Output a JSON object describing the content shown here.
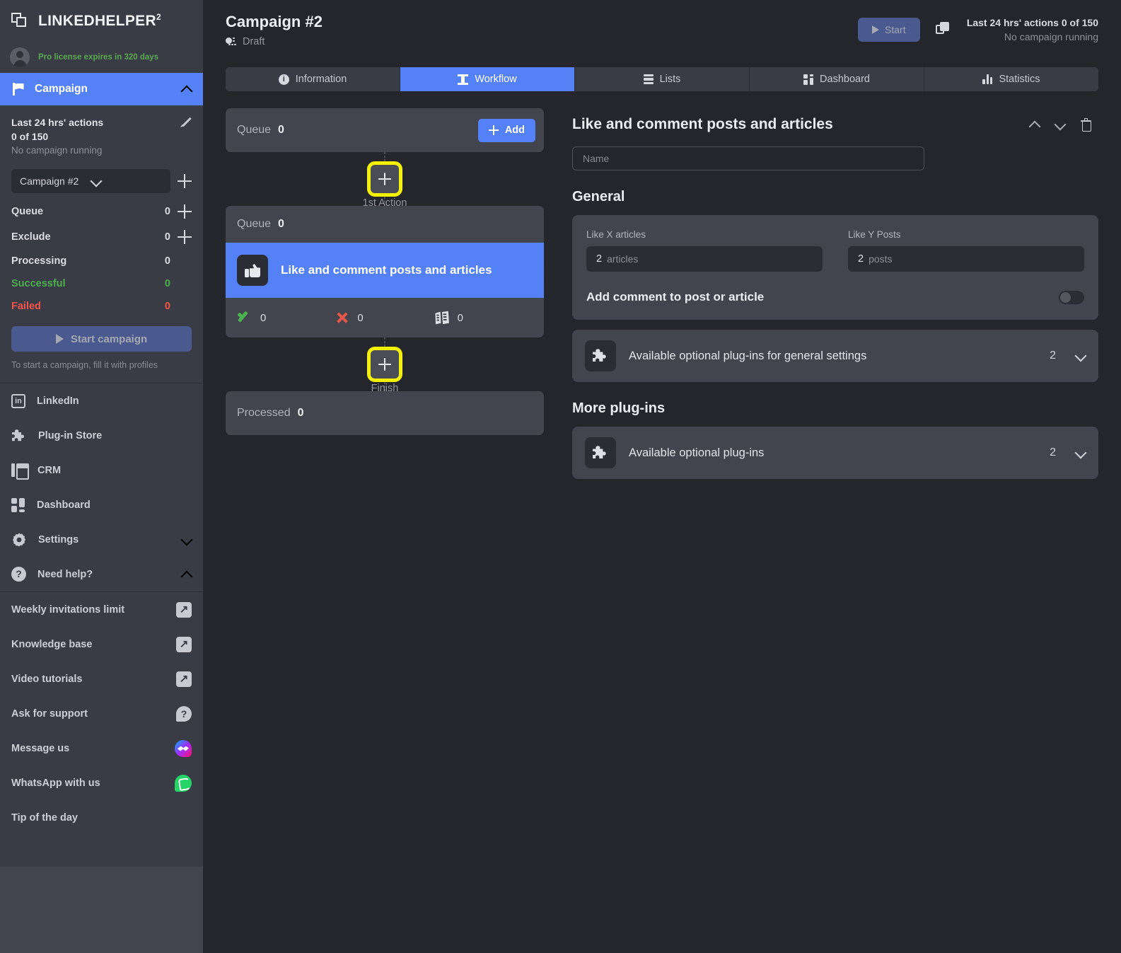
{
  "sidebar": {
    "logo": {
      "text": "LINKEDHELPER",
      "sup": "2"
    },
    "account": {
      "license": "Pro license expires in 320 days"
    },
    "campaign_header": {
      "label": "Campaign"
    },
    "stats": {
      "title": "Last 24 hrs' actions",
      "value": "0 of 150",
      "subtitle": "No campaign running"
    },
    "campaign_select": {
      "value": "Campaign #2"
    },
    "counters": [
      {
        "name": "Queue",
        "value": "0",
        "has_add": true,
        "tone": "normal"
      },
      {
        "name": "Exclude",
        "value": "0",
        "has_add": true,
        "tone": "normal"
      },
      {
        "name": "Processing",
        "value": "0",
        "has_add": false,
        "tone": "normal"
      },
      {
        "name": "Successful",
        "value": "0",
        "has_add": false,
        "tone": "green"
      },
      {
        "name": "Failed",
        "value": "0",
        "has_add": false,
        "tone": "red"
      }
    ],
    "start_campaign": {
      "label": "Start campaign"
    },
    "hint": "To start a campaign, fill it with profiles",
    "nav": [
      {
        "label": "LinkedIn",
        "icon": "linkedin-icon"
      },
      {
        "label": "Plug-in Store",
        "icon": "puzzle-icon"
      },
      {
        "label": "CRM",
        "icon": "crm-icon"
      },
      {
        "label": "Dashboard",
        "icon": "dashboard-icon"
      },
      {
        "label": "Settings",
        "icon": "gear-icon"
      },
      {
        "label": "Need help?",
        "icon": "help-icon"
      }
    ],
    "help_items": [
      {
        "label": "Weekly invitations limit",
        "icon": "external-link-icon"
      },
      {
        "label": "Knowledge base",
        "icon": "external-link-icon"
      },
      {
        "label": "Video tutorials",
        "icon": "external-link-icon"
      },
      {
        "label": "Ask for support",
        "icon": "question-bubble-icon"
      },
      {
        "label": "Message us",
        "icon": "messenger-icon"
      },
      {
        "label": "WhatsApp with us",
        "icon": "whatsapp-icon"
      },
      {
        "label": "Tip of the day",
        "icon": "none"
      }
    ]
  },
  "header": {
    "title": "Campaign #2",
    "status": "Draft",
    "start_button": "Start",
    "meta_line1": "Last 24 hrs' actions 0 of 150",
    "meta_line2": "No campaign running"
  },
  "tabs": [
    {
      "label": "Information",
      "icon": "info-icon",
      "active": false
    },
    {
      "label": "Workflow",
      "icon": "workflow-icon",
      "active": true
    },
    {
      "label": "Lists",
      "icon": "lists-icon",
      "active": false
    },
    {
      "label": "Dashboard",
      "icon": "dashboard-icon",
      "active": false
    },
    {
      "label": "Statistics",
      "icon": "statistics-icon",
      "active": false
    }
  ],
  "workflow": {
    "queue": {
      "label": "Queue",
      "value": "0"
    },
    "add_button": "Add",
    "first_connector_caption": "1st Action",
    "action": {
      "queue_label": "Queue",
      "queue_value": "0",
      "title": "Like and comment posts and articles",
      "stats": [
        {
          "icon": "check-icon",
          "value": "0"
        },
        {
          "icon": "cross-icon",
          "value": "0"
        },
        {
          "icon": "skipped-icon",
          "value": "0"
        }
      ]
    },
    "finish_caption": "Finish",
    "processed": {
      "label": "Processed",
      "value": "0"
    }
  },
  "settings": {
    "title": "Like and comment posts and articles",
    "name_placeholder": "Name",
    "general_heading": "General",
    "fields": [
      {
        "label": "Like X articles",
        "value": "2",
        "unit": "articles"
      },
      {
        "label": "Like Y Posts",
        "value": "2",
        "unit": "posts"
      }
    ],
    "toggle": {
      "label": "Add comment to post or article",
      "on": false
    },
    "general_plugins": {
      "title": "Available optional plug-ins for general settings",
      "count": "2"
    },
    "more_plugins_heading": "More plug-ins",
    "more_plugins": {
      "title": "Available optional plug-ins",
      "count": "2"
    }
  },
  "colors": {
    "accent": "#5481f5",
    "highlight": "#f5f008",
    "success": "#4caf50",
    "danger": "#f4564a",
    "license_green": "#5aa84f"
  }
}
